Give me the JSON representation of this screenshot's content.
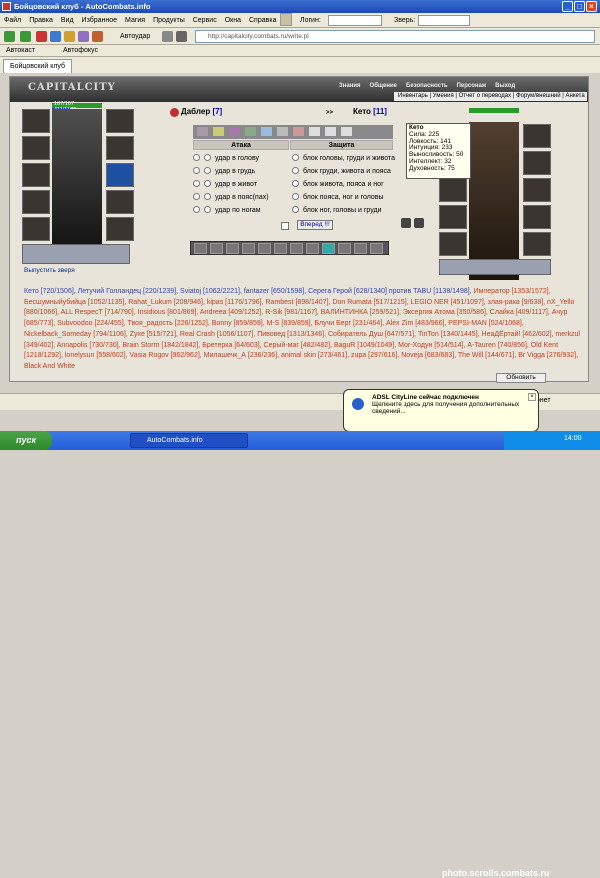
{
  "window": {
    "title": "Бойцовский клуб - AutoCombats.info",
    "minimize": "_",
    "maximize": "□",
    "close": "×"
  },
  "menu": {
    "items": [
      "Файл",
      "Правка",
      "Вид",
      "Избранное",
      "Магия",
      "Продукты",
      "Сервис",
      "Окна",
      "Справка"
    ],
    "login_label": "Логин:",
    "beast_label": "Зверь:"
  },
  "toolbar": {
    "autoattack": "Автоудар",
    "address": "http://capitalcity.combats.ru/write.pl"
  },
  "linkbar": {
    "autoset": "Автокаст",
    "autofocus": "Автофокус"
  },
  "tab": {
    "label": "Бойцовский клуб"
  },
  "game": {
    "logo": "CAPITALCITY",
    "nav": [
      "Знания",
      "Общение",
      "Безопасность",
      "Персонаж",
      "Выход"
    ],
    "subnav": [
      "Инвентарь",
      "Умения",
      "Отчет о переводах",
      "Форум/внешний",
      "Анкета"
    ],
    "player_left": {
      "name": "Даблер",
      "level": "[7]",
      "hp": "167/167",
      "mana": "411/1170"
    },
    "player_right": {
      "name": "Кето",
      "level": "[11]"
    },
    "attack_header": "Атака",
    "defense_header": "Защита",
    "attack_rows": [
      "удар в голову",
      "удар в грудь",
      "удар в живот",
      "удар в пояс(пах)",
      "удар по ногам"
    ],
    "defense_rows": [
      "блок головы, груди и живота",
      "блок груди, живота и пояса",
      "блок живота, пояса и ног",
      "блок пояса, ног и головы",
      "блок ног, головы и груди"
    ],
    "fight_button": "Вперед !!!",
    "release_beast": "Выпустить зверя",
    "tooltip": {
      "name": "Кето",
      "lines": [
        "Сила: 225",
        "Ловкость: 141",
        "Интуиция: 233",
        "Выносливость: 50",
        "Интеллект: 32",
        "Духовность: 75"
      ]
    },
    "refresh": "Обновить",
    "players_text": [
      [
        "b",
        "Кето [720/1506], Летучий Голландец [220/1239], Sviatoj [1062/2221], fantazer [650/1598], Серега Герой [628/1340] против TABU [1138/1498], "
      ],
      [
        "r",
        "Император [1353/1572], Бесшумныйубийца [1052/1135], Rahat_Lukum [208/946], kipas [1176/1796], Rambest [898/1407], Don Rumata [517/1215], LEGIO NER [451/1097], злая-рака [9/638], nX_Yello [880/1066], ALL RespecT [714/790], Insidious [801/869], Andreea [409/1252], R-Sik [981/1167], ВАЛИНТИНКА [259/521], Эксергия Атома [350/586], Слайка [409/1117], Ачур [685/773], Subvoodoo [224/455], Твоя_радость [226/1252], Bonny [859/859], M-S [839/859], Блучи Берг [231/464], Alex Zim [483/966], PEPSI-MAN [524/1068], Nickelback_Someday [794/1106], Zyxe [515/721], Real Crash [1056/1107], Пивовед [1313/1346], Собиратель Душ [647/571], TinTon [1340/1445], НеаДЁртай! [462/602], merkzul [349/402], Annapolis [730/730], Brain Storm [1842/1842], Бретерка [64/603], Серый-маг [482/482], BaguR [1049/1049], Mor-Ходун [514/514], A-Tauren [740/856], Old Kent [1218/1292], lonelysun [558/602], Vasia Rogov [962/962], Милашечк_А [236/236], animal skin [273/461], zupa [297/616], Noveja [683/683], The Will [144/671], Br Vigga [276/932], Black And White"
      ]
    ]
  },
  "statusbar": {
    "balloon_title": "ADSL CityLine сейчас подключен",
    "balloon_text": "Щелкните здесь для получения дополнительных сведений...",
    "internet": "Интернет"
  },
  "taskbar": {
    "start": "пуск",
    "task": "AutoCombats.info",
    "clock": "14:00"
  },
  "watermark": "photo.scrolls.combats.ru"
}
